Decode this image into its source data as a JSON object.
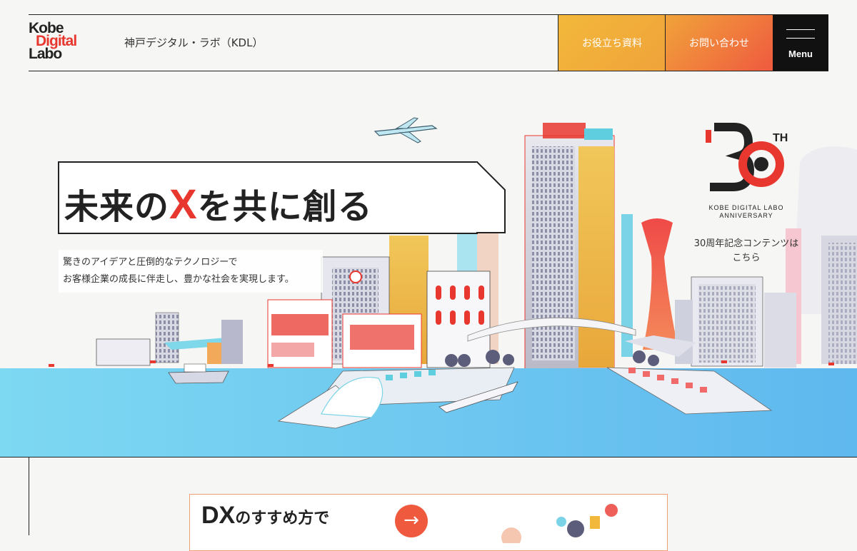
{
  "header": {
    "logo": {
      "line1": "Kobe",
      "line2": "Digital",
      "line3": "Labo"
    },
    "site_name": "神戸デジタル・ラボ（KDL）",
    "resources_label": "お役立ち資料",
    "contact_label": "お問い合わせ",
    "menu_label": "Menu"
  },
  "hero": {
    "catch_before": "未来の",
    "catch_x": "X",
    "catch_after": "を共に創る",
    "lead_line1": "驚きのアイデアと圧倒的なテクノロジーで",
    "lead_line2": "お客様企業の成長に伴走し、豊かな社会を実現します。"
  },
  "anniversary": {
    "number": "30",
    "suffix": "TH",
    "line1": "KOBE DIGITAL LABO",
    "line2": "ANNIVERSARY",
    "caption_line1": "30周年記念コンテンツは",
    "caption_line2": "こちら"
  },
  "dx_banner": {
    "title_big": "DX",
    "title_rest": "のすすめ方で",
    "arrow": "→"
  },
  "colors": {
    "accent_red": "#e8372e",
    "orange": "#ef5a3f",
    "yellow": "#f2b83b",
    "water": "#5ec6ee"
  }
}
